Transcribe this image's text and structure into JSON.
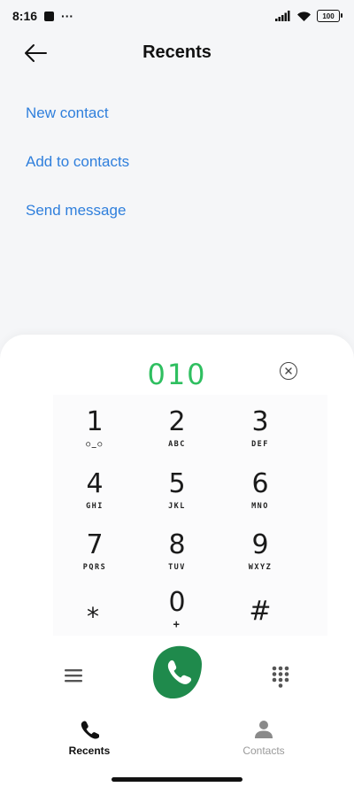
{
  "status": {
    "time": "8:16",
    "dots": "···",
    "battery": "100"
  },
  "header": {
    "title": "Recents"
  },
  "actions": [
    "New contact",
    "Add to contacts",
    "Send message"
  ],
  "dialpad": {
    "number": "010",
    "keys": [
      {
        "digit": "1",
        "letters": "○_○"
      },
      {
        "digit": "2",
        "letters": "ABC"
      },
      {
        "digit": "3",
        "letters": "DEF"
      },
      {
        "digit": "4",
        "letters": "GHI"
      },
      {
        "digit": "5",
        "letters": "JKL"
      },
      {
        "digit": "6",
        "letters": "MNO"
      },
      {
        "digit": "7",
        "letters": "PQRS"
      },
      {
        "digit": "8",
        "letters": "TUV"
      },
      {
        "digit": "9",
        "letters": "WXYZ"
      },
      {
        "digit": "*",
        "letters": ""
      },
      {
        "digit": "0",
        "letters": "+"
      },
      {
        "digit": "#",
        "letters": ""
      }
    ]
  },
  "tabs": [
    {
      "label": "Recents",
      "active": true
    },
    {
      "label": "Contacts",
      "active": false
    }
  ],
  "colors": {
    "accent_link": "#2f7fdc",
    "dialed_number": "#2fbf60",
    "call_button": "#1f8a4c"
  }
}
